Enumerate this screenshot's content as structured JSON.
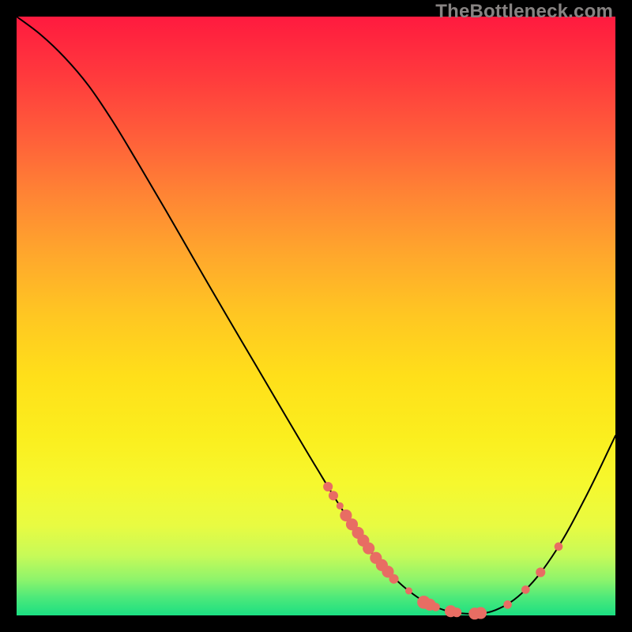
{
  "watermark": "TheBottleneck.com",
  "colors": {
    "background": "#000000",
    "curve_stroke": "#000000",
    "marker_fill": "#e86d63",
    "gradient_top": "#ff1a3f",
    "gradient_bottom": "#1bdf82"
  },
  "chart_data": {
    "type": "line",
    "title": "",
    "xlabel": "",
    "ylabel": "",
    "xlim": [
      0,
      100
    ],
    "ylim": [
      0,
      100
    ],
    "curve_points": [
      {
        "x": 0.0,
        "y": 100.0
      },
      {
        "x": 4.0,
        "y": 97.0
      },
      {
        "x": 8.0,
        "y": 93.2
      },
      {
        "x": 12.0,
        "y": 88.5
      },
      {
        "x": 16.0,
        "y": 82.6
      },
      {
        "x": 20.0,
        "y": 76.0
      },
      {
        "x": 25.0,
        "y": 67.5
      },
      {
        "x": 30.0,
        "y": 58.8
      },
      {
        "x": 35.0,
        "y": 50.2
      },
      {
        "x": 40.0,
        "y": 41.7
      },
      {
        "x": 45.0,
        "y": 33.2
      },
      {
        "x": 50.0,
        "y": 24.8
      },
      {
        "x": 55.0,
        "y": 16.7
      },
      {
        "x": 60.0,
        "y": 9.6
      },
      {
        "x": 65.0,
        "y": 4.5
      },
      {
        "x": 70.0,
        "y": 1.4
      },
      {
        "x": 75.0,
        "y": 0.3
      },
      {
        "x": 80.0,
        "y": 0.9
      },
      {
        "x": 85.0,
        "y": 4.3
      },
      {
        "x": 90.0,
        "y": 10.7
      },
      {
        "x": 95.0,
        "y": 19.7
      },
      {
        "x": 100.0,
        "y": 30.0
      }
    ],
    "markers": [
      {
        "x": 52.0,
        "y": 21.5,
        "r": 0.8
      },
      {
        "x": 52.9,
        "y": 20.0,
        "r": 0.8
      },
      {
        "x": 54.0,
        "y": 18.3,
        "r": 0.6
      },
      {
        "x": 55.0,
        "y": 16.7,
        "r": 1.0
      },
      {
        "x": 56.0,
        "y": 15.2,
        "r": 1.0
      },
      {
        "x": 57.0,
        "y": 13.8,
        "r": 1.0
      },
      {
        "x": 57.9,
        "y": 12.5,
        "r": 1.0
      },
      {
        "x": 58.8,
        "y": 11.2,
        "r": 1.0
      },
      {
        "x": 60.0,
        "y": 9.6,
        "r": 1.0
      },
      {
        "x": 61.0,
        "y": 8.4,
        "r": 1.0
      },
      {
        "x": 62.0,
        "y": 7.3,
        "r": 1.0
      },
      {
        "x": 63.0,
        "y": 6.1,
        "r": 0.8
      },
      {
        "x": 65.5,
        "y": 4.1,
        "r": 0.6
      },
      {
        "x": 68.0,
        "y": 2.2,
        "r": 1.1
      },
      {
        "x": 69.0,
        "y": 1.8,
        "r": 1.0
      },
      {
        "x": 70.0,
        "y": 1.4,
        "r": 0.7
      },
      {
        "x": 72.5,
        "y": 0.7,
        "r": 1.0
      },
      {
        "x": 73.5,
        "y": 0.5,
        "r": 0.8
      },
      {
        "x": 76.5,
        "y": 0.3,
        "r": 1.0
      },
      {
        "x": 77.5,
        "y": 0.4,
        "r": 1.0
      },
      {
        "x": 82.0,
        "y": 1.8,
        "r": 0.7
      },
      {
        "x": 85.0,
        "y": 4.3,
        "r": 0.7
      },
      {
        "x": 87.5,
        "y": 7.2,
        "r": 0.8
      },
      {
        "x": 90.5,
        "y": 11.5,
        "r": 0.7
      }
    ]
  }
}
